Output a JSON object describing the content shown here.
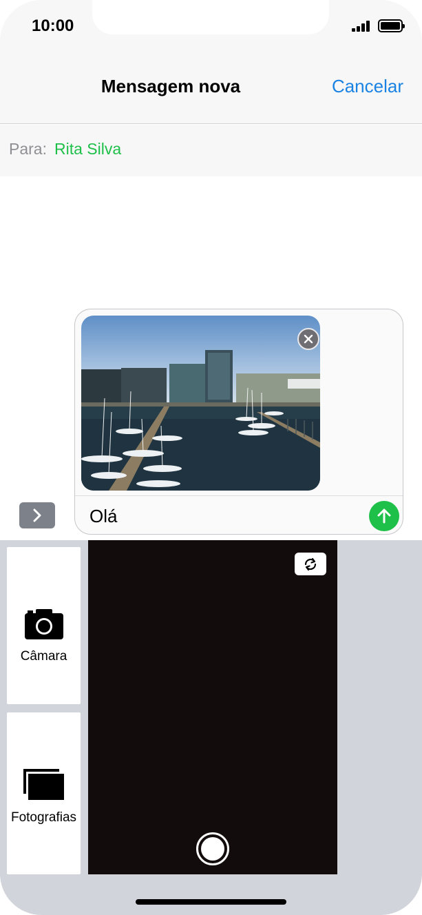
{
  "status_bar": {
    "time": "10:00",
    "signal_icon": "signal-bars-icon",
    "battery_icon": "battery-icon"
  },
  "nav": {
    "title": "Mensagem nova",
    "cancel_label": "Cancelar"
  },
  "recipient": {
    "label": "Para:",
    "name": "Rita Silva"
  },
  "composer": {
    "attachment_icon": "harbour-photo",
    "remove_icon": "close-icon",
    "message": "Olá",
    "send_icon": "arrow-up-icon",
    "expand_icon": "chevron-right-icon"
  },
  "tray": {
    "camera_label": "Câmara",
    "photos_label": "Fotografias",
    "camera_icon": "camera-icon",
    "photos_icon": "photo-stack-icon",
    "flip_icon": "flip-camera-icon",
    "shutter_icon": "shutter-icon"
  },
  "colors": {
    "accent_blue": "#1a82e2",
    "recipient_green": "#1fc04a",
    "send_green": "#1fc04a",
    "tray_background": "#d1d4da",
    "viewfinder": "#130c0c"
  }
}
